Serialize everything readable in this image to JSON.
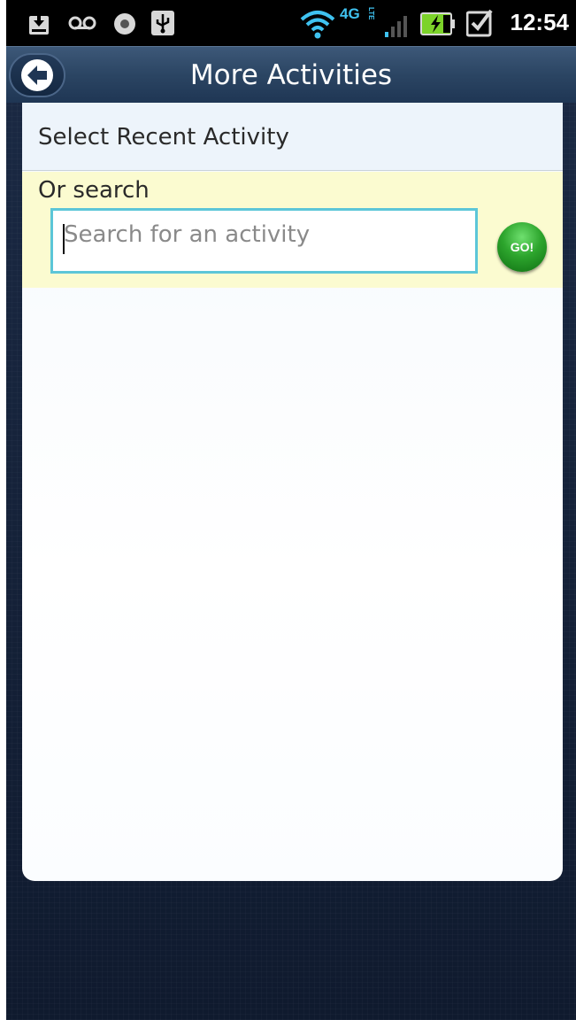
{
  "status_bar": {
    "time": "12:54",
    "network": "4G",
    "network_sub": "LTE",
    "icons": [
      "download-icon",
      "voicemail-icon",
      "record-icon",
      "usb-icon",
      "wifi-icon",
      "signal-icon",
      "battery-charging-icon",
      "checkbox-task-icon"
    ]
  },
  "header": {
    "title": "More Activities",
    "back_icon": "arrow-left-icon"
  },
  "recent": {
    "label": "Select Recent Activity"
  },
  "search": {
    "label": "Or search",
    "placeholder": "Search for an activity",
    "go_label": "GO!"
  },
  "colors": {
    "accent_input_border": "#5cc6d8",
    "search_background": "#fbfbd0",
    "go_button": "#2da52d",
    "header": "#2b4563"
  }
}
